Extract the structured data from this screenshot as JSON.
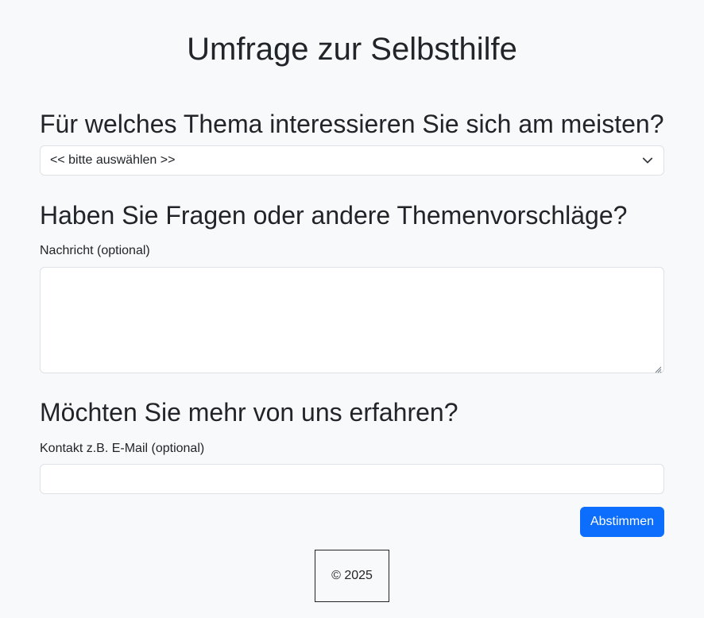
{
  "page": {
    "title": "Umfrage zur Selbsthilfe"
  },
  "topic": {
    "heading": "Für welches Thema interessieren Sie sich am meisten?",
    "select_value": "<< bitte auswählen >>",
    "icon": "chevron-down-icon"
  },
  "message": {
    "heading": "Haben Sie Fragen oder andere Themenvorschläge?",
    "label": "Nachricht (optional)",
    "value": ""
  },
  "contact": {
    "heading": "Möchten Sie mehr von uns erfahren?",
    "label": "Kontakt z.B. E-Mail (optional)",
    "value": ""
  },
  "submit": {
    "label": "Abstimmen"
  },
  "footer": {
    "text": "© 2025"
  },
  "colors": {
    "background": "#f8f9fa",
    "primary": "#0d6efd",
    "text": "#212529",
    "border": "#dee2e6"
  }
}
